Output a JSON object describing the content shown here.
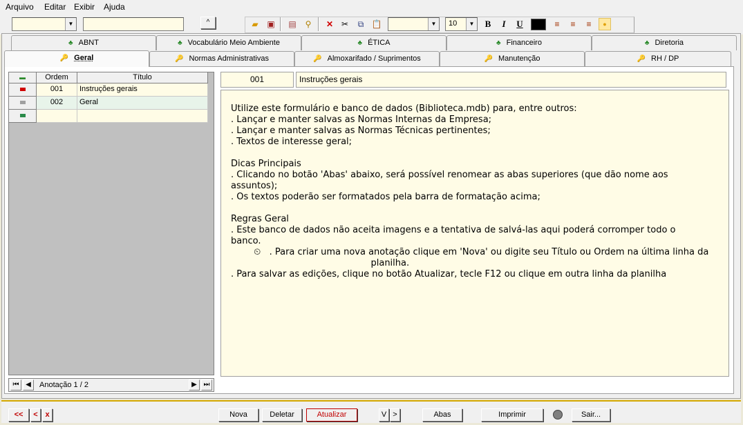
{
  "menu": [
    "Arquivo",
    "Editar",
    "Exibir",
    "Ajuda"
  ],
  "toolbar": {
    "combo1_value": "",
    "text1_value": "",
    "up_label": "^",
    "font_combo_value": "",
    "size_combo_value": "10",
    "bold": "B",
    "italic": "I",
    "underline": "U",
    "text_color": "#000000"
  },
  "tabs_top": [
    {
      "label": "ABNT",
      "icon": "people-icon"
    },
    {
      "label": "Vocabulário Meio Ambiente",
      "icon": "people-icon"
    },
    {
      "label": "ÉTICA",
      "icon": "people-icon"
    },
    {
      "label": "Financeiro",
      "icon": "people-icon"
    },
    {
      "label": "Diretoria",
      "icon": "people-icon"
    }
  ],
  "tabs_bottom": [
    {
      "label": "Geral",
      "icon": "key-icon",
      "active": true
    },
    {
      "label": "Normas Administrativas",
      "icon": "key-icon"
    },
    {
      "label": "Almoxarifado / Suprimentos",
      "icon": "key-icon"
    },
    {
      "label": "Manutenção",
      "icon": "key-icon"
    },
    {
      "label": "RH / DP",
      "icon": "key-icon"
    }
  ],
  "grid": {
    "headers": [
      "Ordem",
      "Título"
    ],
    "rows": [
      {
        "ordem": "001",
        "titulo": "Instruções gerais"
      },
      {
        "ordem": "002",
        "titulo": "Geral"
      },
      {
        "ordem": "",
        "titulo": ""
      }
    ]
  },
  "navigator": {
    "label": "Anotação 1 / 2"
  },
  "detail": {
    "ordem": "001",
    "titulo": "Instruções gerais",
    "memo_lines": [
      "Utilize este formulário e banco de dados (Biblioteca.mdb) para, entre outros:",
      ". Lançar e manter salvas as Normas Internas da Empresa;",
      ". Lançar e manter salvas as Normas Técnicas pertinentes;",
      ". Textos de interesse geral;",
      "",
      "Dicas Principais",
      ". Clicando no botão 'Abas' abaixo, será possível renomear as abas superiores (que dão nome aos",
      "assuntos);",
      ". Os textos poderão ser formatados pela barra de formatação acima;",
      "",
      "Regras Geral",
      ". Este banco de dados não aceita imagens e a tentativa de salvá-las aqui poderá corromper todo o",
      "banco.",
      "        ⏲   . Para criar uma nova anotação clique em 'Nova' ou digite seu Título ou Ordem na última linha da",
      "                                                 planilha.",
      ". Para salvar as edições, clique no botão Atualizar, tecle F12 ou clique em outra linha da planilha"
    ]
  },
  "bottom": {
    "first": "<<",
    "prev": "<",
    "close": "x",
    "nova": "Nova",
    "deletar": "Deletar",
    "atualizar": "Atualizar",
    "v": "V",
    "gt": ">",
    "abas": "Abas",
    "imprimir": "Imprimir",
    "sair": "Sair..."
  }
}
